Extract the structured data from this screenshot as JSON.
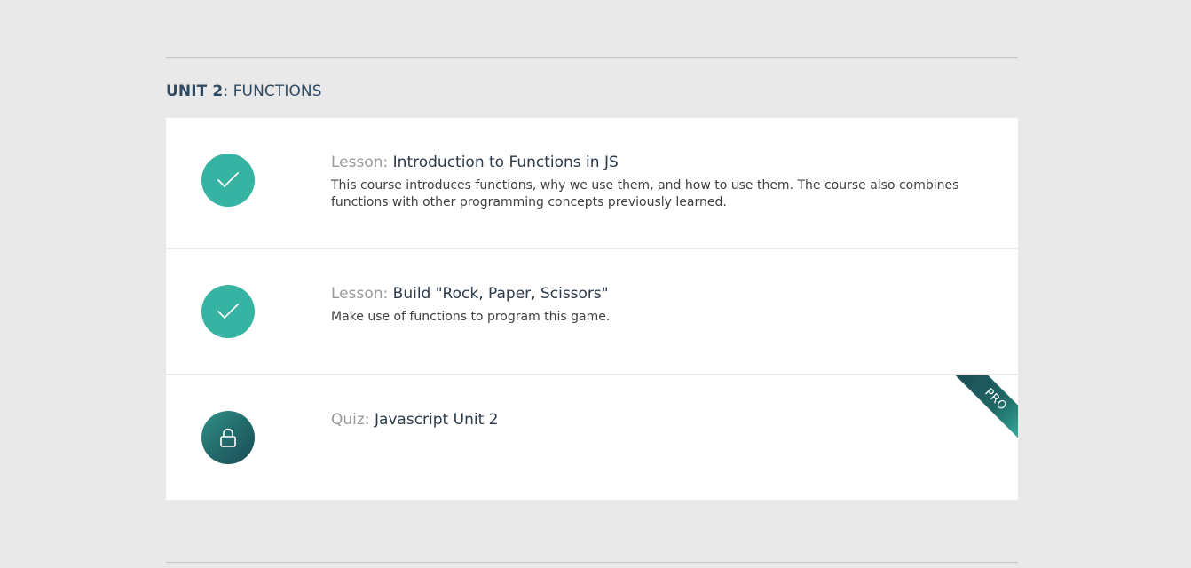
{
  "unit": {
    "label": "UNIT 2",
    "separator": ":",
    "title": " FUNCTIONS"
  },
  "items": [
    {
      "kind": "Lesson:",
      "title": "Introduction to Functions in JS",
      "description": "This course introduces functions, why we use them, and how to use them. The course also combines functions with other programming concepts previously learned.",
      "status": "completed",
      "icon": "checkmark-icon"
    },
    {
      "kind": "Lesson:",
      "title": "Build \"Rock, Paper, Scissors\"",
      "description": "Make use of functions to program this game.",
      "status": "completed",
      "icon": "checkmark-icon"
    },
    {
      "kind": "Quiz:",
      "title": "Javascript Unit 2",
      "description": "",
      "status": "locked",
      "icon": "lock-icon",
      "ribbon": "PRO"
    }
  ],
  "colors": {
    "accent": "#36b3a2",
    "locked": "#1f5e63",
    "background": "#e9e9e9",
    "card": "#ffffff"
  }
}
